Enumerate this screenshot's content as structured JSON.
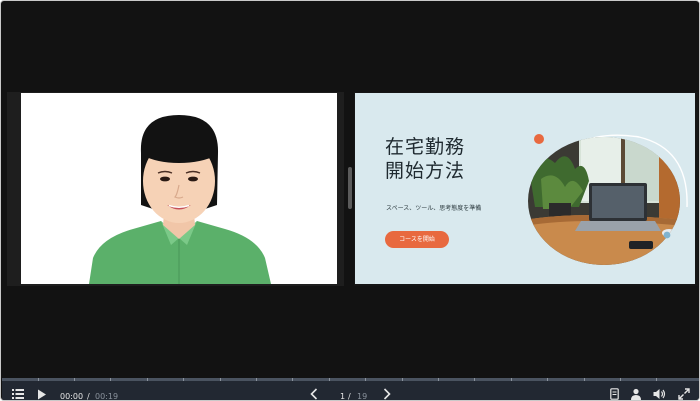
{
  "slide": {
    "title": "在宅勤務\n開始方法",
    "subtitle": "スペース、ツール、思考態度を準備",
    "cta_label": "コースを開始"
  },
  "player": {
    "current_time": "00:00",
    "time_separator": "/",
    "duration": "00:19",
    "current_page": "1",
    "page_separator": "/",
    "total_pages": "19",
    "progress": 0.0
  },
  "icons": {
    "menu": "list-icon",
    "play": "play-icon",
    "prev": "chevron-left-icon",
    "next": "chevron-right-icon",
    "notes": "document-icon",
    "presenter": "person-icon",
    "volume": "volume-icon",
    "fullscreen": "fullscreen-icon"
  },
  "colors": {
    "accent": "#e8693f",
    "slide_bg": "#d9e9ee",
    "controls_bg": "#222832"
  }
}
